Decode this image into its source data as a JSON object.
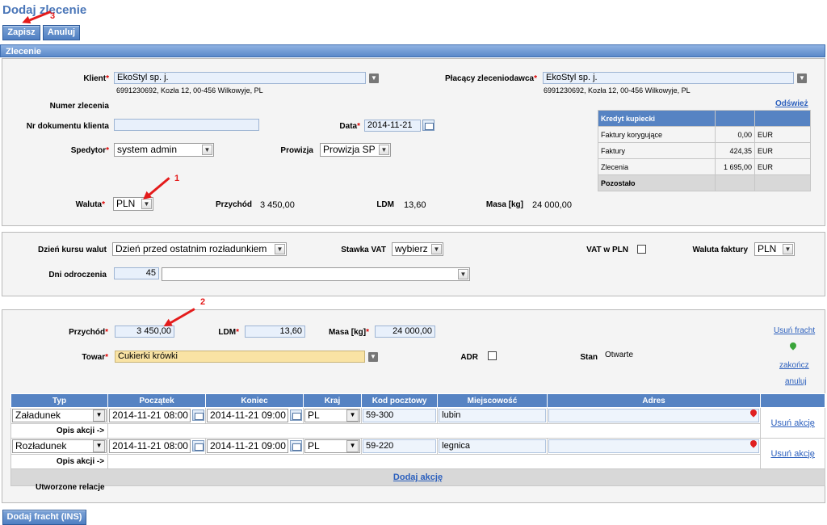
{
  "page_title": "Dodaj zlecenie",
  "toolbar": {
    "save_label": "Zapisz",
    "cancel_label": "Anuluj"
  },
  "section_title": "Zlecenie",
  "order": {
    "client_label": "Klient",
    "client_value": "EkoStyl sp. j.",
    "client_address": "6991230692, Kozła 12, 00-456 Wilkowyje, PL",
    "payer_label": "Płacący zleceniodawca",
    "payer_value": "EkoStyl sp. j.",
    "payer_address": "6991230692, Kozła 12, 00-456 Wilkowyje, PL",
    "refresh_link": "Odśwież",
    "order_number_label": "Numer zlecenia",
    "client_doc_label": "Nr dokumentu klienta",
    "date_label": "Data",
    "date_value": "2014-11-21",
    "forwarder_label": "Spedytor",
    "forwarder_value": "system admin",
    "commission_label": "Prowizja",
    "commission_value": "Prowizja SP",
    "currency_label": "Waluta",
    "currency_value": "PLN",
    "revenue_label": "Przychód",
    "revenue_value": "3 450,00",
    "ldm_label": "LDM",
    "ldm_value": "13,60",
    "mass_label": "Masa [kg]",
    "mass_value": "24 000,00"
  },
  "credit": {
    "header": "Kredyt kupiecki",
    "rows": [
      {
        "label": "Faktury korygujące",
        "amount": "0,00",
        "currency": "EUR"
      },
      {
        "label": "Faktury",
        "amount": "424,35",
        "currency": "EUR"
      },
      {
        "label": "Zlecenia",
        "amount": "1 695,00",
        "currency": "EUR"
      }
    ],
    "footer": "Pozostało"
  },
  "settings": {
    "rate_day_label": "Dzień kursu walut",
    "rate_day_value": "Dzień przed ostatnim rozładunkiem",
    "vat_rate_label": "Stawka VAT",
    "vat_rate_value": "wybierz",
    "vat_pln_label": "VAT w PLN",
    "invoice_currency_label": "Waluta faktury",
    "invoice_currency_value": "PLN",
    "deferral_label": "Dni odroczenia",
    "deferral_value": "45"
  },
  "freight": {
    "revenue_label": "Przychód",
    "revenue_value": "3 450,00",
    "ldm_label": "LDM",
    "ldm_value": "13,60",
    "mass_label": "Masa [kg]",
    "mass_value": "24 000,00",
    "goods_label": "Towar",
    "goods_value": "Cukierki krówki",
    "adr_label": "ADR",
    "status_label": "Stan",
    "status_value": "Otwarte",
    "remove_freight": "Usuń fracht",
    "finish": "zakończ",
    "cancel": "anuluj",
    "columns": [
      "Typ",
      "Początek",
      "Koniec",
      "Kraj",
      "Kod pocztowy",
      "Miejscowość",
      "Adres"
    ],
    "actions": [
      {
        "type": "Załadunek",
        "start": "2014-11-21 08:00",
        "end": "2014-11-21 09:00",
        "country": "PL",
        "postal": "59-300",
        "city": "lubin",
        "address": "",
        "remove": "Usuń akcję",
        "desc": "Opis akcji ->"
      },
      {
        "type": "Rozładunek",
        "start": "2014-11-21 08:00",
        "end": "2014-11-21 09:00",
        "country": "PL",
        "postal": "59-220",
        "city": "legnica",
        "address": "",
        "remove": "Usuń akcję",
        "desc": "Opis akcji ->"
      }
    ],
    "add_action": "Dodaj akcję",
    "relations_label": "Utworzone relacje"
  },
  "bottom_button": "Dodaj fracht (INS)",
  "annotations": {
    "n1": "1",
    "n2": "2",
    "n3": "3"
  },
  "colors": {
    "accent": "#5683c3",
    "title": "#4a76b8",
    "arrow": "#e41b1b"
  }
}
